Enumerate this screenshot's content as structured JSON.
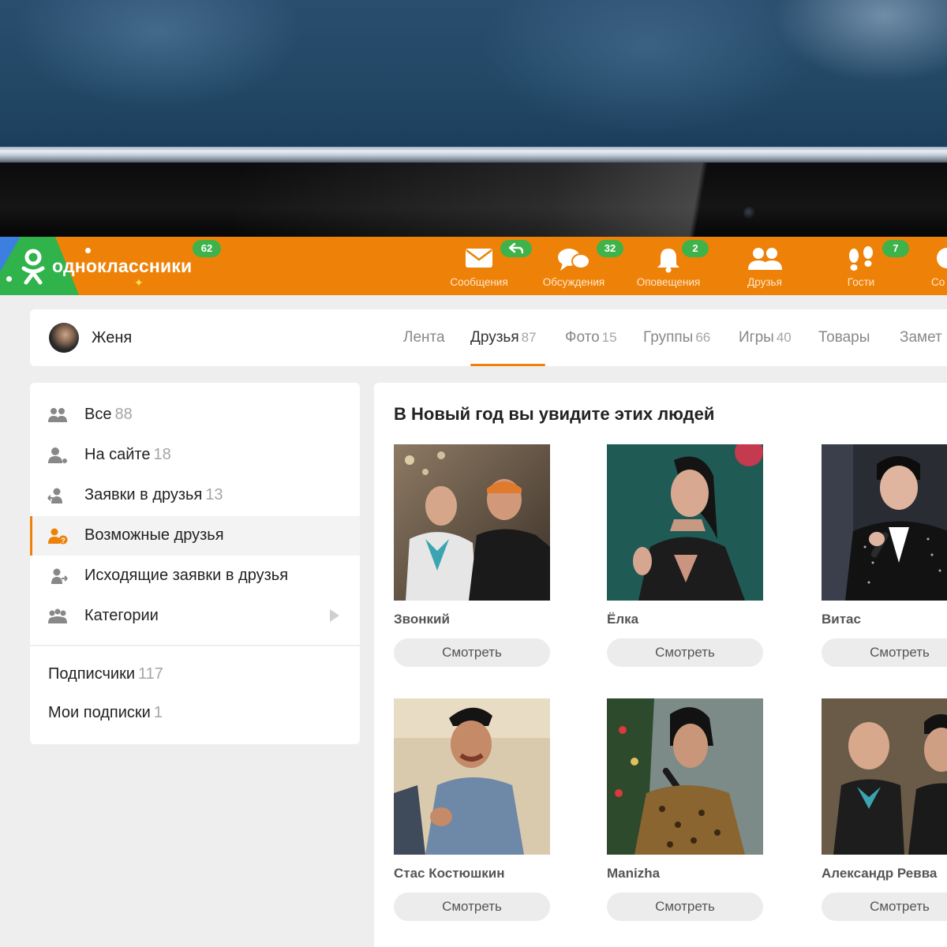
{
  "logo": {
    "text": "одноклассники",
    "badge": "62"
  },
  "nav": [
    {
      "label": "Сообщения",
      "icon": "envelope-icon",
      "badge": ""
    },
    {
      "label": "Обсуждения",
      "icon": "chat-bubbles-icon",
      "badge": "32"
    },
    {
      "label": "Оповещения",
      "icon": "bell-icon",
      "badge": "2"
    },
    {
      "label": "Друзья",
      "icon": "friends-icon",
      "badge": ""
    },
    {
      "label": "Гости",
      "icon": "footprints-icon",
      "badge": "7"
    },
    {
      "label": "Co",
      "icon": "circle-icon",
      "badge": ""
    }
  ],
  "colors": {
    "brand_orange": "#ee8208",
    "badge_green": "#3fb24a",
    "accent_underline": "#ee8208"
  },
  "profile": {
    "name": "Женя",
    "tabs": [
      {
        "label": "Лента",
        "count": ""
      },
      {
        "label": "Друзья",
        "count": "87"
      },
      {
        "label": "Фото",
        "count": "15"
      },
      {
        "label": "Группы",
        "count": "66"
      },
      {
        "label": "Игры",
        "count": "40"
      },
      {
        "label": "Товары",
        "count": ""
      },
      {
        "label": "Замет",
        "count": ""
      }
    ]
  },
  "sidebar": {
    "items": [
      {
        "label": "Все",
        "count": "88",
        "icon": "people-icon"
      },
      {
        "label": "На сайте",
        "count": "18",
        "icon": "person-online-icon"
      },
      {
        "label": "Заявки в друзья",
        "count": "13",
        "icon": "incoming-request-icon"
      },
      {
        "label": "Возможные друзья",
        "count": "",
        "icon": "possible-friend-icon"
      },
      {
        "label": "Исходящие заявки в друзья",
        "count": "",
        "icon": "outgoing-request-icon"
      },
      {
        "label": "Категории",
        "count": "",
        "icon": "categories-icon"
      }
    ],
    "subscribers": {
      "label": "Подписчики",
      "count": "117"
    },
    "subscriptions": {
      "label": "Мои подписки",
      "count": "1"
    }
  },
  "main": {
    "title": "В Новый год вы увидите этих людей",
    "people": [
      {
        "name": "Звонкий",
        "button": "Смотреть"
      },
      {
        "name": "Ёлка",
        "button": "Смотреть"
      },
      {
        "name": "Витас",
        "button": "Смотреть"
      },
      {
        "name": "Стас Костюшкин",
        "button": "Смотреть"
      },
      {
        "name": "Manizha",
        "button": "Смотреть"
      },
      {
        "name": "Александр Ревва",
        "button": "Смотреть"
      }
    ]
  }
}
